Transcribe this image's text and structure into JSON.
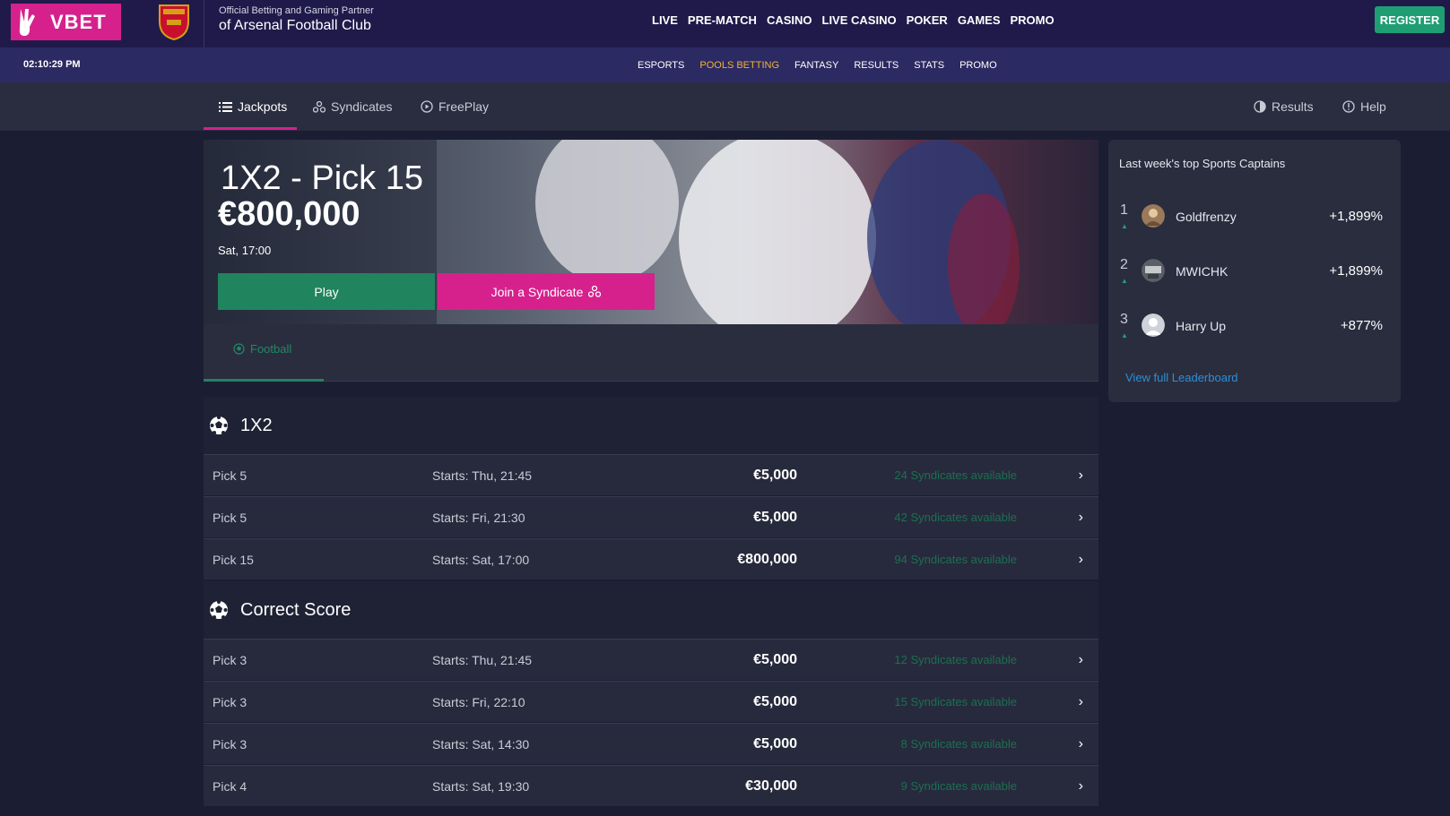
{
  "brand": {
    "name": "VBET"
  },
  "partner": {
    "line1": "Official Betting and Gaming Partner",
    "line2": "of Arsenal Football Club"
  },
  "main_nav": [
    "LIVE",
    "PRE-MATCH",
    "CASINO",
    "LIVE CASINO",
    "POKER",
    "GAMES",
    "PROMO"
  ],
  "register_label": "REGISTER",
  "clock": "02:10:29 PM",
  "sub_nav": [
    {
      "label": "ESPORTS",
      "active": false
    },
    {
      "label": "POOLS BETTING",
      "active": true
    },
    {
      "label": "FANTASY",
      "active": false
    },
    {
      "label": "RESULTS",
      "active": false
    },
    {
      "label": "STATS",
      "active": false
    },
    {
      "label": "PROMO",
      "active": false
    }
  ],
  "tabs": {
    "jackpots": "Jackpots",
    "syndicates": "Syndicates",
    "freeplay": "FreePlay",
    "results": "Results",
    "help": "Help"
  },
  "hero": {
    "title": "1X2 - Pick 15",
    "amount": "€800,000",
    "date": "Sat, 17:00",
    "play_label": "Play",
    "syndicate_label": "Join a Syndicate"
  },
  "filter": {
    "football": "Football"
  },
  "sections": [
    {
      "name": "1X2",
      "rows": [
        {
          "pick": "Pick 5",
          "starts": "Starts: Thu, 21:45",
          "amount": "€5,000",
          "syndicates": "24 Syndicates available"
        },
        {
          "pick": "Pick 5",
          "starts": "Starts: Fri, 21:30",
          "amount": "€5,000",
          "syndicates": "42 Syndicates available"
        },
        {
          "pick": "Pick 15",
          "starts": "Starts: Sat, 17:00",
          "amount": "€800,000",
          "syndicates": "94 Syndicates available"
        }
      ]
    },
    {
      "name": "Correct Score",
      "rows": [
        {
          "pick": "Pick 3",
          "starts": "Starts: Thu, 21:45",
          "amount": "€5,000",
          "syndicates": "12 Syndicates available"
        },
        {
          "pick": "Pick 3",
          "starts": "Starts: Fri, 22:10",
          "amount": "€5,000",
          "syndicates": "15 Syndicates available"
        },
        {
          "pick": "Pick 3",
          "starts": "Starts: Sat, 14:30",
          "amount": "€5,000",
          "syndicates": "8 Syndicates available"
        },
        {
          "pick": "Pick 4",
          "starts": "Starts: Sat, 19:30",
          "amount": "€30,000",
          "syndicates": "9 Syndicates available"
        }
      ]
    }
  ],
  "leaderboard": {
    "title": "Last week's top Sports Captains",
    "entries": [
      {
        "rank": "1",
        "name": "Goldfrenzy",
        "pct": "+1,899%"
      },
      {
        "rank": "2",
        "name": "MWICHK",
        "pct": "+1,899%"
      },
      {
        "rank": "3",
        "name": "Harry Up",
        "pct": "+877%"
      }
    ],
    "view_full": "View full Leaderboard"
  },
  "colors": {
    "brand_pink": "#d6218d",
    "play_green": "#20845f",
    "active_nav": "#f0b23a",
    "link_blue": "#2d8fd6"
  }
}
